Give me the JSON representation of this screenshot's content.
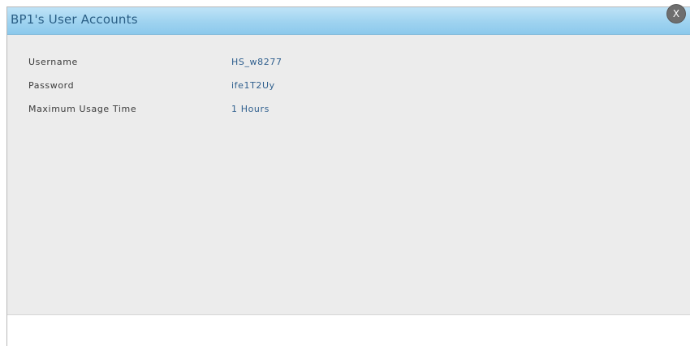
{
  "dialog": {
    "title": "BP1's User Accounts",
    "close_label": "X"
  },
  "account": {
    "fields": [
      {
        "label": "Username",
        "value": "HS_w8277"
      },
      {
        "label": "Password",
        "value": "ife1T2Uy"
      },
      {
        "label": "Maximum Usage Time",
        "value": "1 Hours"
      }
    ]
  },
  "colors": {
    "titlebar": "#9fd3f0",
    "title_text": "#2b5f86",
    "panel_background": "#ececec",
    "value_text": "#2f5f8e",
    "close_button": "#6e6e6e"
  },
  "icons": {
    "close": "close-icon"
  }
}
